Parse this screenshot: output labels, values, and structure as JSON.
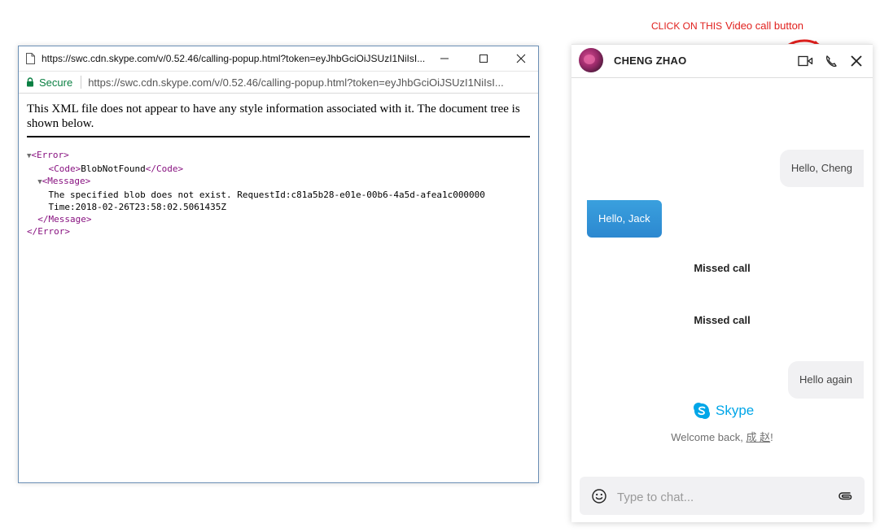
{
  "popup": {
    "title": "https://swc.cdn.skype.com/v/0.52.46/calling-popup.html?token=eyJhbGciOiJSUzI1NiIsI...",
    "secure_label": "Secure",
    "url_scheme_host": "https://swc.cdn.skype.com",
    "url_path": "/v/0.52.46/calling-popup.html?token=eyJhbGciOiJSUzI1NiIsI...",
    "xml_notice": "This XML file does not appear to have any style information associated with it. The document tree is shown below.",
    "xml": {
      "error_open": "<Error>",
      "code_open": "<Code>",
      "code_value": "BlobNotFound",
      "code_close": "</Code>",
      "message_open": "<Message>",
      "message_line1": "The specified blob does not exist. RequestId:c81a5b28-e01e-00b6-4a5d-afea1c000000",
      "message_line2": "Time:2018-02-26T23:58:02.5061435Z",
      "message_close": "</Message>",
      "error_close": "</Error>"
    }
  },
  "annotation": {
    "text": "CLICK ON THIS",
    "tail": "Video call button",
    "color": "#e0201d"
  },
  "chat": {
    "contact_name": "CHENG ZHAO",
    "messages": [
      {
        "direction": "in",
        "text": "Hello, Cheng"
      },
      {
        "direction": "out",
        "text": "Hello, Jack"
      },
      {
        "direction": "event",
        "text": "Missed call"
      },
      {
        "direction": "event",
        "text": "Missed call"
      },
      {
        "direction": "in",
        "text": "Hello again"
      }
    ],
    "brand": "Skype",
    "welcome_prefix": "Welcome back, ",
    "welcome_name": "成 赵",
    "welcome_suffix": "!",
    "input_placeholder": "Type to chat...",
    "accent_color": "#2c88d0",
    "brand_color": "#00a6e8"
  }
}
